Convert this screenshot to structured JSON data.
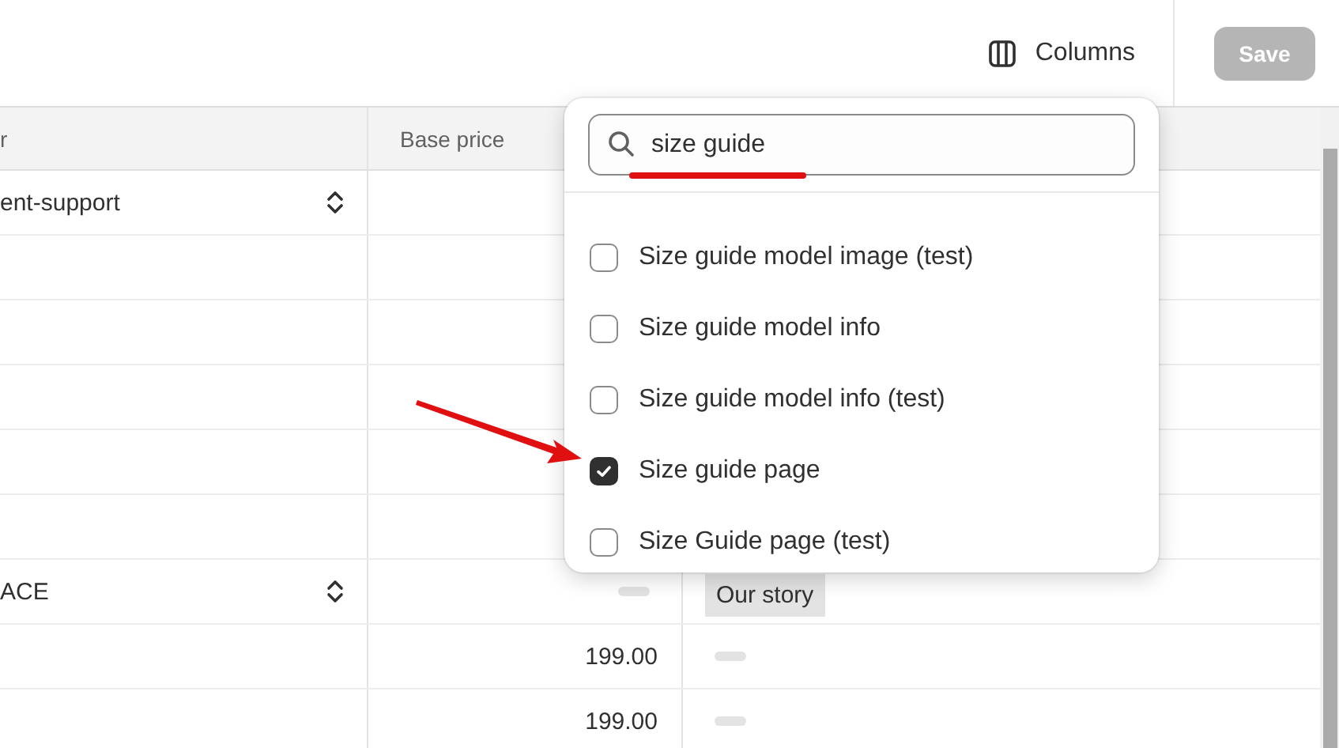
{
  "toolbar": {
    "columns_button": "Columns",
    "save_button": {
      "label": "Save",
      "disabled": true
    }
  },
  "table": {
    "columns": [
      "r",
      "Base price"
    ],
    "rows": [
      {
        "cells": [
          {
            "kind": "select",
            "text": "ent-support"
          },
          {
            "kind": "empty"
          },
          {
            "kind": "empty"
          }
        ]
      },
      {
        "cells": [
          {
            "kind": "empty"
          },
          {
            "kind": "empty"
          },
          {
            "kind": "empty"
          }
        ]
      },
      {
        "cells": [
          {
            "kind": "empty"
          },
          {
            "kind": "empty"
          },
          {
            "kind": "empty"
          }
        ]
      },
      {
        "cells": [
          {
            "kind": "empty"
          },
          {
            "kind": "empty"
          },
          {
            "kind": "empty"
          }
        ]
      },
      {
        "cells": [
          {
            "kind": "empty"
          },
          {
            "kind": "empty"
          },
          {
            "kind": "empty"
          }
        ]
      },
      {
        "cells": [
          {
            "kind": "empty"
          },
          {
            "kind": "empty"
          },
          {
            "kind": "empty"
          }
        ]
      },
      {
        "cells": [
          {
            "kind": "select",
            "text": "ACE"
          },
          {
            "kind": "dash"
          },
          {
            "kind": "tag",
            "text": "Our story"
          }
        ]
      },
      {
        "cells": [
          {
            "kind": "empty"
          },
          {
            "kind": "number",
            "text": "199.00"
          },
          {
            "kind": "dash"
          }
        ]
      },
      {
        "cells": [
          {
            "kind": "empty"
          },
          {
            "kind": "number",
            "text": "199.00"
          },
          {
            "kind": "dash"
          }
        ]
      }
    ]
  },
  "columns_popover": {
    "search": {
      "value": "size guide"
    },
    "options": [
      {
        "label": "Size guide model image (test)",
        "checked": false
      },
      {
        "label": "Size guide model info",
        "checked": false
      },
      {
        "label": "Size guide model info (test)",
        "checked": false
      },
      {
        "label": "Size guide page",
        "checked": true
      },
      {
        "label": "Size Guide page (test)",
        "checked": false
      }
    ]
  }
}
